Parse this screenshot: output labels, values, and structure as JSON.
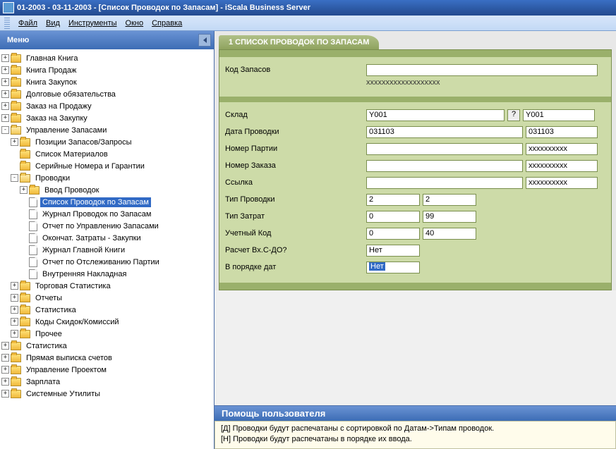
{
  "window": {
    "title": "01-2003 - 03-11-2003 - [Список Проводок по Запасам] - iScala Business Server"
  },
  "menubar": {
    "items": [
      "Файл",
      "Вид",
      "Инструменты",
      "Окно",
      "Справка"
    ]
  },
  "sidebar": {
    "title": "Меню",
    "tree": [
      {
        "l": 0,
        "exp": "+",
        "icon": "folder",
        "label": "Главная Книга"
      },
      {
        "l": 0,
        "exp": "+",
        "icon": "folder",
        "label": "Книга Продаж"
      },
      {
        "l": 0,
        "exp": "+",
        "icon": "folder",
        "label": "Книга Закупок"
      },
      {
        "l": 0,
        "exp": "+",
        "icon": "folder",
        "label": "Долговые обязательства"
      },
      {
        "l": 0,
        "exp": "+",
        "icon": "folder",
        "label": "Заказ на Продажу"
      },
      {
        "l": 0,
        "exp": "+",
        "icon": "folder",
        "label": "Заказ на Закупку"
      },
      {
        "l": 0,
        "exp": "-",
        "icon": "folder-open",
        "label": "Управление Запасами"
      },
      {
        "l": 1,
        "exp": "+",
        "icon": "folder",
        "label": "Позиции Запасов/Запросы"
      },
      {
        "l": 1,
        "exp": "",
        "icon": "folder",
        "label": "Список Материалов"
      },
      {
        "l": 1,
        "exp": "",
        "icon": "folder",
        "label": "Серийные Номера и Гарантии"
      },
      {
        "l": 1,
        "exp": "-",
        "icon": "folder-open",
        "label": "Проводки"
      },
      {
        "l": 2,
        "exp": "+",
        "icon": "folder",
        "label": "Ввод Проводок"
      },
      {
        "l": 2,
        "exp": "",
        "icon": "doc",
        "label": "Список Проводок по Запасам",
        "selected": true
      },
      {
        "l": 2,
        "exp": "",
        "icon": "doc",
        "label": "Журнал Проводок по Запасам"
      },
      {
        "l": 2,
        "exp": "",
        "icon": "doc",
        "label": "Отчет по Управлению Запасами"
      },
      {
        "l": 2,
        "exp": "",
        "icon": "doc",
        "label": "Окончат. Затраты - Закупки"
      },
      {
        "l": 2,
        "exp": "",
        "icon": "doc",
        "label": "Журнал Главной Книги"
      },
      {
        "l": 2,
        "exp": "",
        "icon": "doc",
        "label": "Отчет по Отслеживанию Партии"
      },
      {
        "l": 2,
        "exp": "",
        "icon": "doc",
        "label": "Внутренняя Накладная"
      },
      {
        "l": 1,
        "exp": "+",
        "icon": "folder",
        "label": "Торговая Статистика"
      },
      {
        "l": 1,
        "exp": "+",
        "icon": "folder",
        "label": "Отчеты"
      },
      {
        "l": 1,
        "exp": "+",
        "icon": "folder",
        "label": "Статистика"
      },
      {
        "l": 1,
        "exp": "+",
        "icon": "folder",
        "label": "Коды Скидок/Комиссий"
      },
      {
        "l": 1,
        "exp": "+",
        "icon": "folder",
        "label": "Прочее"
      },
      {
        "l": 0,
        "exp": "+",
        "icon": "folder",
        "label": "Статистика"
      },
      {
        "l": 0,
        "exp": "+",
        "icon": "folder",
        "label": "Прямая выписка счетов"
      },
      {
        "l": 0,
        "exp": "+",
        "icon": "folder",
        "label": "Управление Проектом"
      },
      {
        "l": 0,
        "exp": "+",
        "icon": "folder",
        "label": "Зарплата"
      },
      {
        "l": 0,
        "exp": "+",
        "icon": "folder",
        "label": "Системные Утилиты"
      }
    ]
  },
  "form": {
    "tab": "1 СПИСОК ПРОВОДОК ПО ЗАПАСАМ",
    "top": {
      "stock_code_label": "Код Запасов",
      "stock_code_value": "",
      "stock_code_mask": "xxxxxxxxxxxxxxxxxxx"
    },
    "fields": {
      "warehouse_label": "Склад",
      "warehouse_from": "Y001",
      "warehouse_to": "Y001",
      "date_label": "Дата Проводки",
      "date_from": "031103",
      "date_to": "031103",
      "batch_label": "Номер Партии",
      "batch_from": "",
      "batch_to": "xxxxxxxxxx",
      "order_label": "Номер Заказа",
      "order_from": "",
      "order_to": "xxxxxxxxxx",
      "ref_label": "Ссылка",
      "ref_from": "",
      "ref_to": "xxxxxxxxxx",
      "tr_type_label": "Тип Проводки",
      "tr_type_from": "2",
      "tr_type_to": "2",
      "cost_type_label": "Тип Затрат",
      "cost_type_from": "0",
      "cost_type_to": "99",
      "acct_code_label": "Учетный Код",
      "acct_code_from": "0",
      "acct_code_to": "40",
      "calc_label": "Расчет Вх.С-ДО?",
      "calc_value": "Нет",
      "order_by_label": "В порядке дат",
      "order_by_value": "Нет"
    }
  },
  "help": {
    "title": "Помощь пользователя",
    "line1": "[Д]  Проводки будут распечатаны с сортировкой по Датам->Типам проводок.",
    "line2": "[Н]  Проводки будут распечатаны в порядке их ввода."
  }
}
